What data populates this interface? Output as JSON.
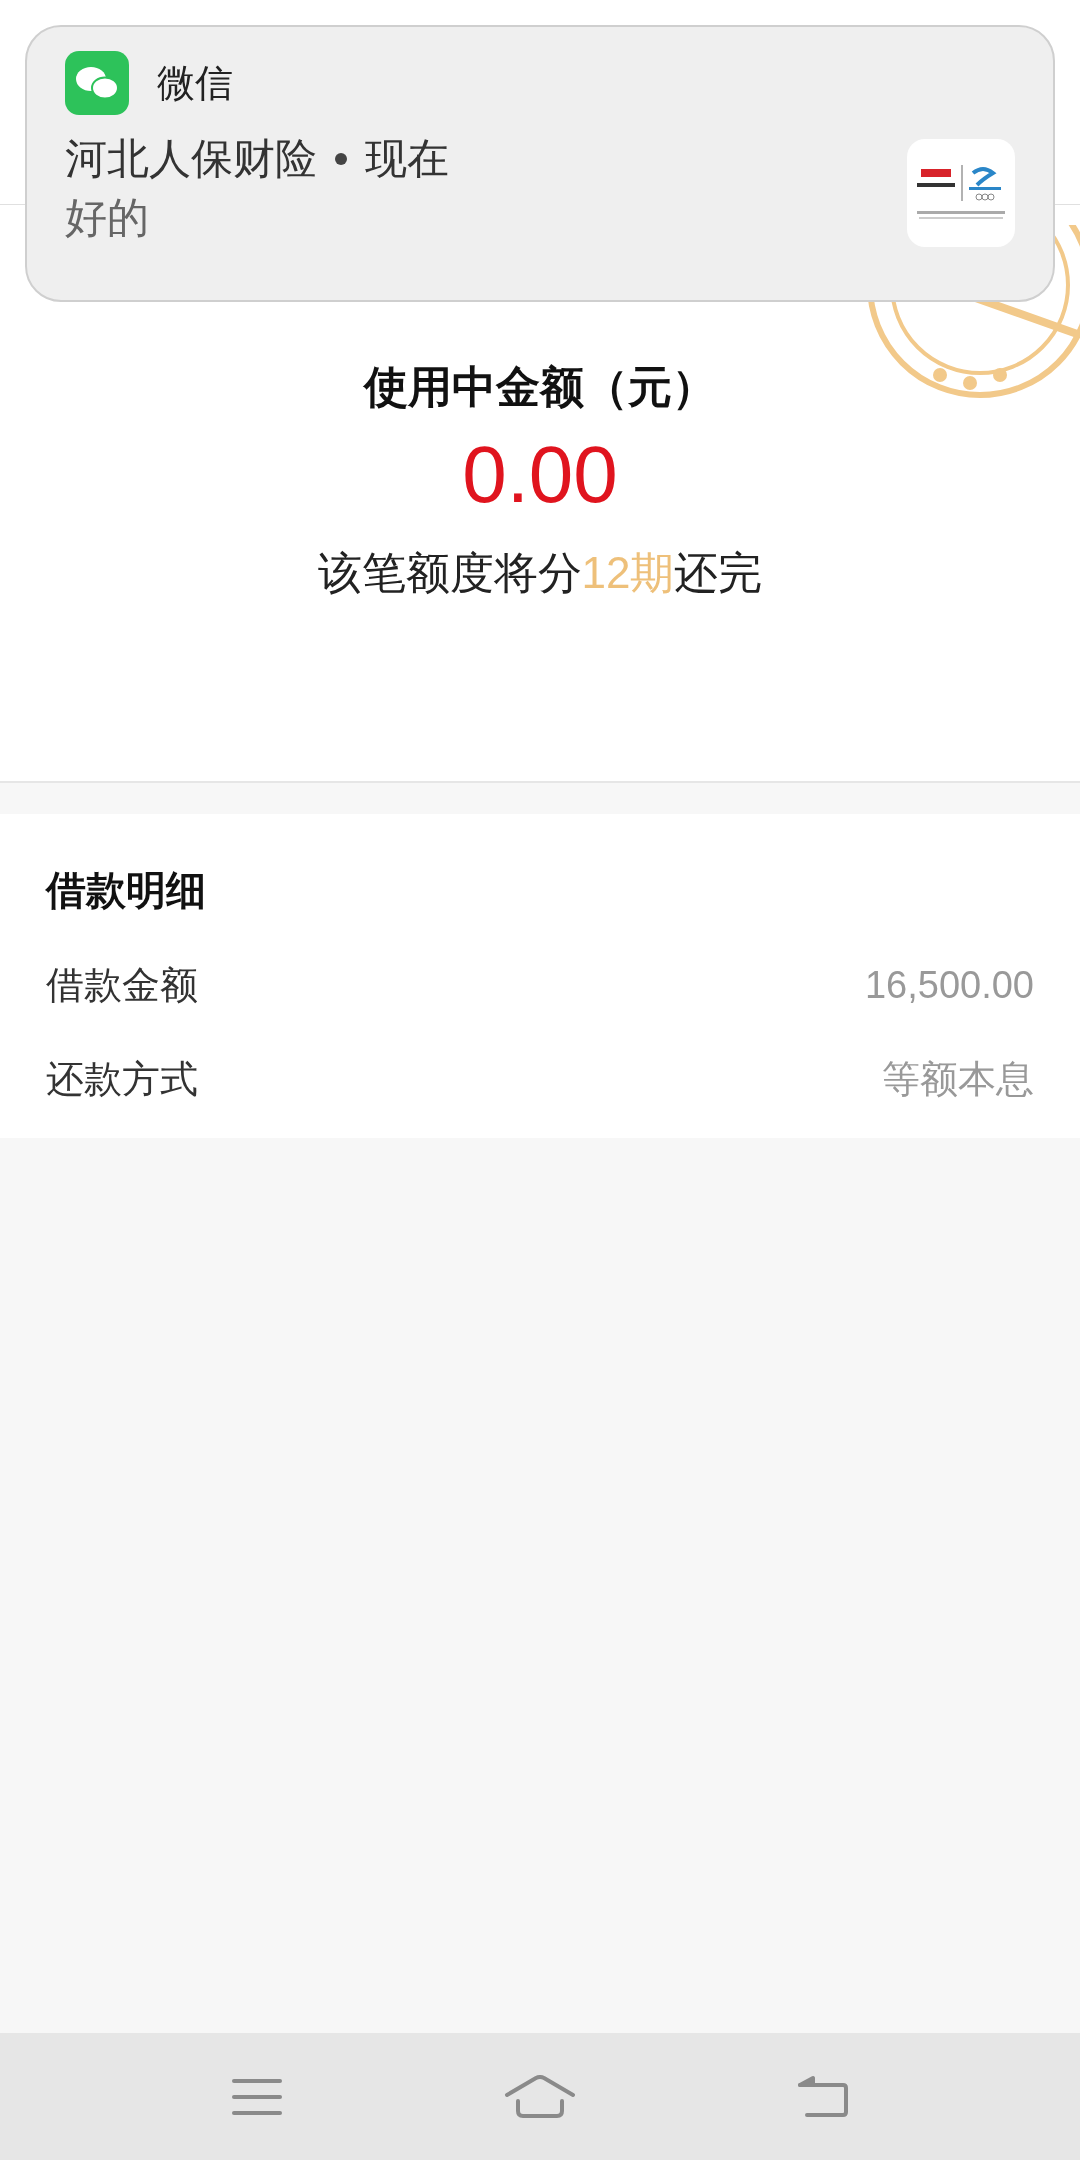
{
  "notification": {
    "app_name": "微信",
    "sender": "河北人保财险",
    "time": "现在",
    "message": "好的"
  },
  "summary": {
    "title": "使用中金额（元）",
    "amount": "0.00",
    "note_parts": [
      {
        "text": "该笔额度将分",
        "highlight": false
      },
      {
        "text": "12期",
        "highlight": true
      },
      {
        "text": "还完",
        "highlight": false
      }
    ]
  },
  "details": {
    "title": "借款明细",
    "rows": [
      {
        "label": "借款金额",
        "value": "16,500.00"
      },
      {
        "label": "还款方式",
        "value": "等额本息"
      }
    ]
  },
  "nav_bar": [
    {
      "kind": "menu"
    },
    {
      "kind": "home"
    },
    {
      "kind": "back"
    }
  ]
}
